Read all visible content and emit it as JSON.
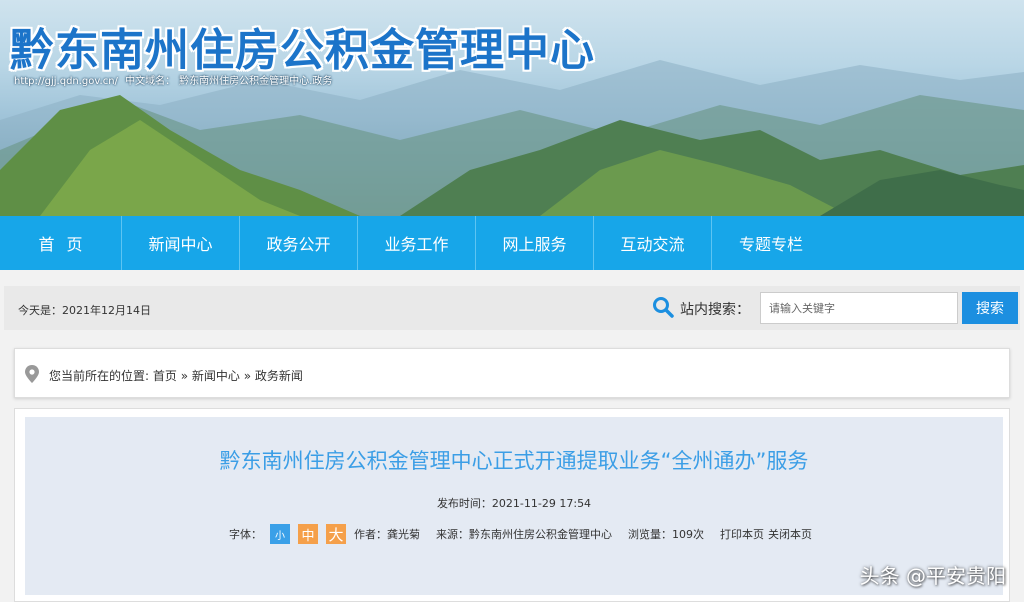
{
  "banner": {
    "title": "黔东南州住房公积金管理中心",
    "url_text": "http://gjj.qdn.gov.cn/",
    "domain_label": "中文域名：",
    "domain_value": "黔东南州住房公积金管理中心.政务"
  },
  "nav": {
    "items": [
      {
        "label": "首页"
      },
      {
        "label": "新闻中心"
      },
      {
        "label": "政务公开"
      },
      {
        "label": "业务工作"
      },
      {
        "label": "网上服务"
      },
      {
        "label": "互动交流"
      },
      {
        "label": "专题专栏"
      }
    ]
  },
  "searchbar": {
    "today": "今天是：2021年12月14日",
    "label": "站内搜索：",
    "placeholder": "请输入关键字",
    "button": "搜索"
  },
  "breadcrumb": {
    "prefix": "您当前所在的位置: ",
    "items": [
      "首页",
      "新闻中心",
      "政务新闻"
    ],
    "separator": " » "
  },
  "article": {
    "title": "黔东南州住房公积金管理中心正式开通提取业务“全州通办”服务",
    "pubtime": "发布时间：2021-11-29 17:54",
    "font_label": "字体：",
    "font_small": "小",
    "font_mid": "中",
    "font_big": "大",
    "author": "作者：龚光菊",
    "source": "来源：黔东南州住房公积金管理中心",
    "views": "浏览量：109次",
    "print": "打印本页",
    "close": "关闭本页"
  },
  "watermark": "头条 @平安贵阳",
  "colors": {
    "nav_bg": "#17a6e9",
    "title_blue": "#1c74c9",
    "article_title": "#3b9ee6",
    "search_btn": "#1c8fe0",
    "font_small": "#3aa0e8",
    "font_orange": "#f5a04a"
  }
}
